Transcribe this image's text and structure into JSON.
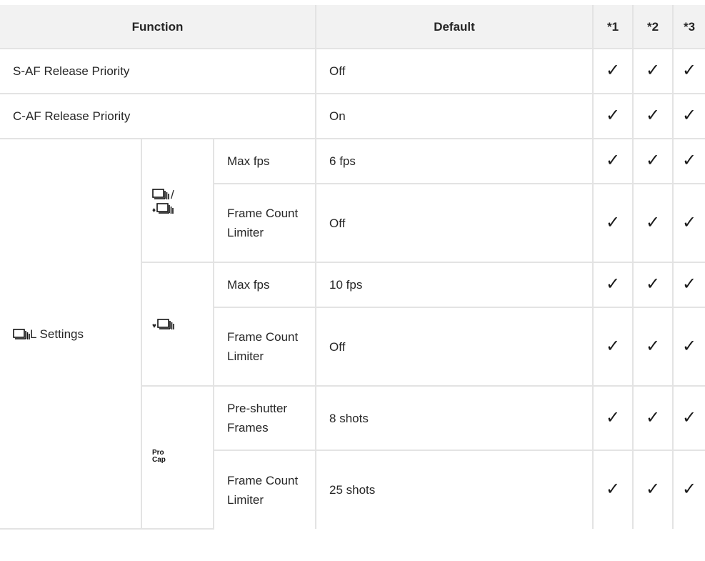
{
  "headers": {
    "function": "Function",
    "default": "Default",
    "c1": "*1",
    "c2": "*2",
    "c3": "*3"
  },
  "check_glyph": "✓",
  "rows": {
    "s_af": {
      "function": "S-AF Release Priority",
      "default": "Off"
    },
    "c_af": {
      "function": "C-AF Release Priority",
      "default": "On"
    },
    "l_settings": {
      "label": "L Settings",
      "icon": "sequential-shooting-icon",
      "group1": {
        "icon": "sequential-and-silent-sequential-icon",
        "separator": "/",
        "silent_marker": "♦",
        "max_fps": {
          "label": "Max fps",
          "default": "6 fps"
        },
        "limiter": {
          "label": "Frame Count Limiter",
          "default": "Off"
        }
      },
      "group2": {
        "icon": "silent-sequential-icon",
        "silent_marker": "♥",
        "max_fps": {
          "label": "Max fps",
          "default": "10 fps"
        },
        "limiter": {
          "label": "Frame Count Limiter",
          "default": "Off"
        }
      },
      "group3": {
        "icon": "pro-capture-icon",
        "icon_text_1": "Pro",
        "icon_text_2": "Cap",
        "pre_shutter": {
          "label": "Pre-shutter Frames",
          "default": "8 shots"
        },
        "limiter": {
          "label": "Frame Count Limiter",
          "default": "25 shots"
        }
      }
    }
  }
}
